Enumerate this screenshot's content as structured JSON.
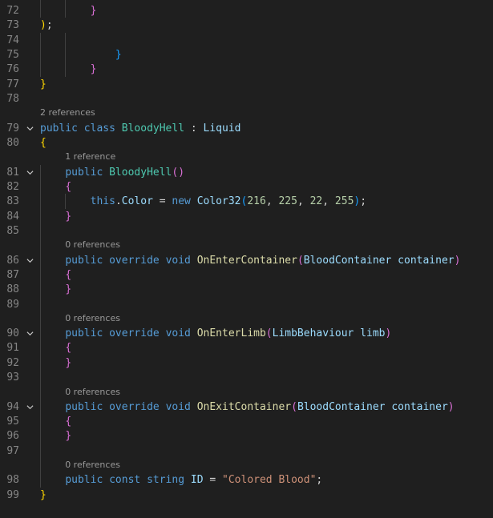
{
  "colors": {
    "background": "#1f1f1f",
    "line_number": "#858585",
    "code_lens": "#999999",
    "keyword": "#569cd6",
    "type": "#4ec9b0",
    "method": "#dcdcaa",
    "string": "#ce9178",
    "number": "#b5cea8",
    "variable": "#9cdcfe",
    "bracket_level_1": "#ffd700",
    "bracket_level_2": "#da70d6",
    "bracket_level_3": "#179fff"
  },
  "lines": [
    {
      "num": "72",
      "fold": false,
      "tokens": [
        {
          "t": "        "
        },
        {
          "t": "}",
          "c": "b2"
        }
      ]
    },
    {
      "num": "73",
      "fold": false,
      "tokens": [
        {
          "t": ")",
          "c": "b1"
        },
        {
          "t": ";"
        }
      ]
    },
    {
      "num": "74",
      "fold": false,
      "tokens": []
    },
    {
      "num": "75",
      "fold": false,
      "tokens": [
        {
          "t": "            "
        },
        {
          "t": "}",
          "c": "b3"
        }
      ]
    },
    {
      "num": "76",
      "fold": false,
      "tokens": [
        {
          "t": "        "
        },
        {
          "t": "}",
          "c": "b2"
        }
      ]
    },
    {
      "num": "77",
      "fold": false,
      "tokens": [
        {
          "t": "}",
          "c": "b1"
        }
      ]
    },
    {
      "num": "78",
      "fold": false,
      "tokens": []
    },
    {
      "num": "79",
      "fold": true,
      "lens": "2 references",
      "tokens": [
        {
          "t": "public",
          "c": "kw"
        },
        {
          "t": " "
        },
        {
          "t": "class",
          "c": "kw"
        },
        {
          "t": " "
        },
        {
          "t": "BloodyHell",
          "c": "type"
        },
        {
          "t": " : "
        },
        {
          "t": "Liquid",
          "c": "var"
        }
      ]
    },
    {
      "num": "80",
      "fold": false,
      "tokens": [
        {
          "t": "{",
          "c": "b1"
        }
      ]
    },
    {
      "num": "81",
      "fold": true,
      "lens": "1 reference",
      "tokens": [
        {
          "t": "    "
        },
        {
          "t": "public",
          "c": "kw"
        },
        {
          "t": " "
        },
        {
          "t": "BloodyHell",
          "c": "type"
        },
        {
          "t": "()",
          "c": "b2"
        }
      ]
    },
    {
      "num": "82",
      "fold": false,
      "tokens": [
        {
          "t": "    "
        },
        {
          "t": "{",
          "c": "b2"
        }
      ]
    },
    {
      "num": "83",
      "fold": false,
      "tokens": [
        {
          "t": "        "
        },
        {
          "t": "this",
          "c": "kw"
        },
        {
          "t": "."
        },
        {
          "t": "Color",
          "c": "var"
        },
        {
          "t": " = "
        },
        {
          "t": "new",
          "c": "kw"
        },
        {
          "t": " "
        },
        {
          "t": "Color32",
          "c": "var"
        },
        {
          "t": "(",
          "c": "b3"
        },
        {
          "t": "216",
          "c": "num"
        },
        {
          "t": ", "
        },
        {
          "t": "225",
          "c": "num"
        },
        {
          "t": ", "
        },
        {
          "t": "22",
          "c": "num"
        },
        {
          "t": ", "
        },
        {
          "t": "255",
          "c": "num"
        },
        {
          "t": ")",
          "c": "b3"
        },
        {
          "t": ";"
        }
      ]
    },
    {
      "num": "84",
      "fold": false,
      "tokens": [
        {
          "t": "    "
        },
        {
          "t": "}",
          "c": "b2"
        }
      ]
    },
    {
      "num": "85",
      "fold": false,
      "tokens": []
    },
    {
      "num": "86",
      "fold": true,
      "lens": "0 references",
      "tokens": [
        {
          "t": "    "
        },
        {
          "t": "public",
          "c": "kw"
        },
        {
          "t": " "
        },
        {
          "t": "override",
          "c": "kw"
        },
        {
          "t": " "
        },
        {
          "t": "void",
          "c": "kw"
        },
        {
          "t": " "
        },
        {
          "t": "OnEnterContainer",
          "c": "fn"
        },
        {
          "t": "(",
          "c": "b2"
        },
        {
          "t": "BloodContainer",
          "c": "var"
        },
        {
          "t": " "
        },
        {
          "t": "container",
          "c": "var"
        },
        {
          "t": ")",
          "c": "b2"
        }
      ]
    },
    {
      "num": "87",
      "fold": false,
      "tokens": [
        {
          "t": "    "
        },
        {
          "t": "{",
          "c": "b2"
        }
      ]
    },
    {
      "num": "88",
      "fold": false,
      "tokens": [
        {
          "t": "    "
        },
        {
          "t": "}",
          "c": "b2"
        }
      ]
    },
    {
      "num": "89",
      "fold": false,
      "tokens": []
    },
    {
      "num": "90",
      "fold": true,
      "lens": "0 references",
      "tokens": [
        {
          "t": "    "
        },
        {
          "t": "public",
          "c": "kw"
        },
        {
          "t": " "
        },
        {
          "t": "override",
          "c": "kw"
        },
        {
          "t": " "
        },
        {
          "t": "void",
          "c": "kw"
        },
        {
          "t": " "
        },
        {
          "t": "OnEnterLimb",
          "c": "fn"
        },
        {
          "t": "(",
          "c": "b2"
        },
        {
          "t": "LimbBehaviour",
          "c": "var"
        },
        {
          "t": " "
        },
        {
          "t": "limb",
          "c": "var"
        },
        {
          "t": ")",
          "c": "b2"
        }
      ]
    },
    {
      "num": "91",
      "fold": false,
      "tokens": [
        {
          "t": "    "
        },
        {
          "t": "{",
          "c": "b2"
        }
      ]
    },
    {
      "num": "92",
      "fold": false,
      "tokens": [
        {
          "t": "    "
        },
        {
          "t": "}",
          "c": "b2"
        }
      ]
    },
    {
      "num": "93",
      "fold": false,
      "tokens": []
    },
    {
      "num": "94",
      "fold": true,
      "lens": "0 references",
      "tokens": [
        {
          "t": "    "
        },
        {
          "t": "public",
          "c": "kw"
        },
        {
          "t": " "
        },
        {
          "t": "override",
          "c": "kw"
        },
        {
          "t": " "
        },
        {
          "t": "void",
          "c": "kw"
        },
        {
          "t": " "
        },
        {
          "t": "OnExitContainer",
          "c": "fn"
        },
        {
          "t": "(",
          "c": "b2"
        },
        {
          "t": "BloodContainer",
          "c": "var"
        },
        {
          "t": " "
        },
        {
          "t": "container",
          "c": "var"
        },
        {
          "t": ")",
          "c": "b2"
        }
      ]
    },
    {
      "num": "95",
      "fold": false,
      "tokens": [
        {
          "t": "    "
        },
        {
          "t": "{",
          "c": "b2"
        }
      ]
    },
    {
      "num": "96",
      "fold": false,
      "tokens": [
        {
          "t": "    "
        },
        {
          "t": "}",
          "c": "b2"
        }
      ]
    },
    {
      "num": "97",
      "fold": false,
      "tokens": []
    },
    {
      "num": "98",
      "fold": false,
      "lens": "0 references",
      "tokens": [
        {
          "t": "    "
        },
        {
          "t": "public",
          "c": "kw"
        },
        {
          "t": " "
        },
        {
          "t": "const",
          "c": "kw"
        },
        {
          "t": " "
        },
        {
          "t": "string",
          "c": "kw"
        },
        {
          "t": " "
        },
        {
          "t": "ID",
          "c": "var"
        },
        {
          "t": " = "
        },
        {
          "t": "\"Colored Blood\"",
          "c": "str"
        },
        {
          "t": ";"
        }
      ]
    },
    {
      "num": "99",
      "fold": false,
      "tokens": [
        {
          "t": "}",
          "c": "b1"
        }
      ]
    }
  ]
}
